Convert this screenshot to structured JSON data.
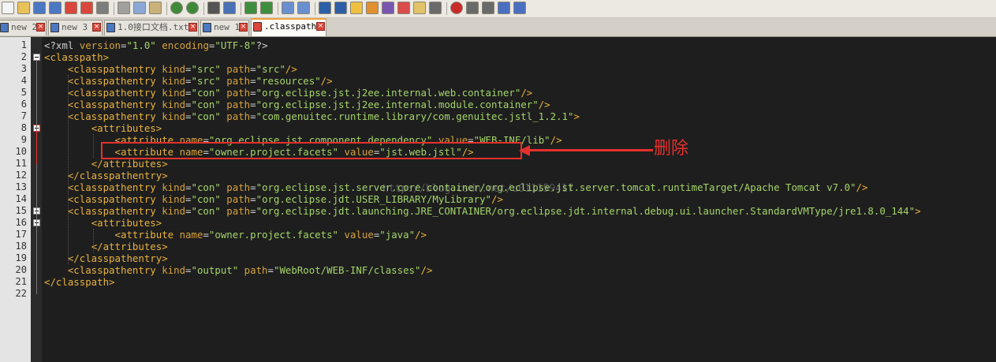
{
  "toolbar": {
    "buttons": [
      "new-file-icon",
      "open-file-icon",
      "save-icon",
      "save-all-icon",
      "close-icon",
      "close-all-icon",
      "print-icon",
      "cut-icon",
      "copy-icon",
      "paste-icon",
      "undo-icon",
      "redo-icon",
      "find-icon",
      "replace-icon",
      "zoom-in-icon",
      "zoom-out-icon",
      "sync-scroll-icon",
      "sync-h-icon",
      "wrap-icon",
      "show-all-chars-icon",
      "indent-guide-icon",
      "lang-icon",
      "function-list-icon",
      "doc-map-icon",
      "folder-icon",
      "monitor-icon",
      "record-macro-icon",
      "stop-macro-icon",
      "play-macro-icon",
      "run-macro-icon",
      "save-macro-icon"
    ]
  },
  "tabs": [
    {
      "label": "new 2",
      "active": false
    },
    {
      "label": "new 3",
      "active": false
    },
    {
      "label": "1.0接口文档.txt",
      "active": false
    },
    {
      "label": "new 1",
      "active": false
    },
    {
      "label": ".classpath",
      "active": true
    }
  ],
  "editor": {
    "line_numbers": [
      "1",
      "2",
      "3",
      "4",
      "5",
      "6",
      "7",
      "8",
      "9",
      "10",
      "11",
      "12",
      "13",
      "14",
      "15",
      "16",
      "17",
      "18",
      "19",
      "20",
      "21",
      "22"
    ],
    "lines": [
      [
        [
          "t",
          "<?xml "
        ],
        [
          "a",
          "version"
        ],
        [
          "t",
          "="
        ],
        [
          "v",
          "\"1.0\""
        ],
        [
          "t",
          " "
        ],
        [
          "a",
          "encoding"
        ],
        [
          "t",
          "="
        ],
        [
          "v",
          "\"UTF-8\""
        ],
        [
          "t",
          "?>"
        ]
      ],
      [
        [
          "g",
          "<classpath>"
        ]
      ],
      [
        [
          "s",
          "    "
        ],
        [
          "g",
          "<classpathentry "
        ],
        [
          "a",
          "kind"
        ],
        [
          "t",
          "="
        ],
        [
          "v",
          "\"src\""
        ],
        [
          "t",
          " "
        ],
        [
          "a",
          "path"
        ],
        [
          "t",
          "="
        ],
        [
          "v",
          "\"src\""
        ],
        [
          "g",
          "/>"
        ]
      ],
      [
        [
          "s",
          "    "
        ],
        [
          "g",
          "<classpathentry "
        ],
        [
          "a",
          "kind"
        ],
        [
          "t",
          "="
        ],
        [
          "v",
          "\"src\""
        ],
        [
          "t",
          " "
        ],
        [
          "a",
          "path"
        ],
        [
          "t",
          "="
        ],
        [
          "v",
          "\"resources\""
        ],
        [
          "g",
          "/>"
        ]
      ],
      [
        [
          "s",
          "    "
        ],
        [
          "g",
          "<classpathentry "
        ],
        [
          "a",
          "kind"
        ],
        [
          "t",
          "="
        ],
        [
          "v",
          "\"con\""
        ],
        [
          "t",
          " "
        ],
        [
          "a",
          "path"
        ],
        [
          "t",
          "="
        ],
        [
          "v",
          "\"org.eclipse.jst.j2ee.internal.web.container\""
        ],
        [
          "g",
          "/>"
        ]
      ],
      [
        [
          "s",
          "    "
        ],
        [
          "g",
          "<classpathentry "
        ],
        [
          "a",
          "kind"
        ],
        [
          "t",
          "="
        ],
        [
          "v",
          "\"con\""
        ],
        [
          "t",
          " "
        ],
        [
          "a",
          "path"
        ],
        [
          "t",
          "="
        ],
        [
          "v",
          "\"org.eclipse.jst.j2ee.internal.module.container\""
        ],
        [
          "g",
          "/>"
        ]
      ],
      [
        [
          "s",
          "    "
        ],
        [
          "g",
          "<classpathentry "
        ],
        [
          "a",
          "kind"
        ],
        [
          "t",
          "="
        ],
        [
          "v",
          "\"con\""
        ],
        [
          "t",
          " "
        ],
        [
          "a",
          "path"
        ],
        [
          "t",
          "="
        ],
        [
          "v",
          "\"com.genuitec.runtime.library/com.genuitec.jstl_1.2.1\""
        ],
        [
          "g",
          ">"
        ]
      ],
      [
        [
          "s",
          "        "
        ],
        [
          "g",
          "<attributes>"
        ]
      ],
      [
        [
          "s",
          "            "
        ],
        [
          "g",
          "<attribute "
        ],
        [
          "a",
          "name"
        ],
        [
          "t",
          "="
        ],
        [
          "v",
          "\"org.eclipse.jst.component.dependency\""
        ],
        [
          "t",
          " "
        ],
        [
          "a",
          "value"
        ],
        [
          "t",
          "="
        ],
        [
          "v",
          "\"WEB-INF/lib\""
        ],
        [
          "g",
          "/>"
        ]
      ],
      [
        [
          "s",
          "            "
        ],
        [
          "g",
          "<attribute "
        ],
        [
          "a",
          "name"
        ],
        [
          "t",
          "="
        ],
        [
          "v",
          "\"owner.project.facets\""
        ],
        [
          "t",
          " "
        ],
        [
          "a",
          "value"
        ],
        [
          "t",
          "="
        ],
        [
          "v",
          "\"jst.web.jstl\""
        ],
        [
          "g",
          "/>"
        ]
      ],
      [
        [
          "s",
          "        "
        ],
        [
          "g",
          "</attributes>"
        ]
      ],
      [
        [
          "s",
          "    "
        ],
        [
          "g",
          "</classpathentry>"
        ]
      ],
      [
        [
          "s",
          "    "
        ],
        [
          "g",
          "<classpathentry "
        ],
        [
          "a",
          "kind"
        ],
        [
          "t",
          "="
        ],
        [
          "v",
          "\"con\""
        ],
        [
          "t",
          " "
        ],
        [
          "a",
          "path"
        ],
        [
          "t",
          "="
        ],
        [
          "v",
          "\"org.eclipse.jst.server.core.container/org.eclipse.jst.server.tomcat.runtimeTarget/Apache Tomcat v7.0\""
        ],
        [
          "g",
          "/>"
        ]
      ],
      [
        [
          "s",
          "    "
        ],
        [
          "g",
          "<classpathentry "
        ],
        [
          "a",
          "kind"
        ],
        [
          "t",
          "="
        ],
        [
          "v",
          "\"con\""
        ],
        [
          "t",
          " "
        ],
        [
          "a",
          "path"
        ],
        [
          "t",
          "="
        ],
        [
          "v",
          "\"org.eclipse.jdt.USER_LIBRARY/MyLibrary\""
        ],
        [
          "g",
          "/>"
        ]
      ],
      [
        [
          "s",
          "    "
        ],
        [
          "g",
          "<classpathentry "
        ],
        [
          "a",
          "kind"
        ],
        [
          "t",
          "="
        ],
        [
          "v",
          "\"con\""
        ],
        [
          "t",
          " "
        ],
        [
          "a",
          "path"
        ],
        [
          "t",
          "="
        ],
        [
          "v",
          "\"org.eclipse.jdt.launching.JRE_CONTAINER/org.eclipse.jdt.internal.debug.ui.launcher.StandardVMType/jre1.8.0_144\""
        ],
        [
          "g",
          ">"
        ]
      ],
      [
        [
          "s",
          "        "
        ],
        [
          "g",
          "<attributes>"
        ]
      ],
      [
        [
          "s",
          "            "
        ],
        [
          "g",
          "<attribute "
        ],
        [
          "a",
          "name"
        ],
        [
          "t",
          "="
        ],
        [
          "v",
          "\"owner.project.facets\""
        ],
        [
          "t",
          " "
        ],
        [
          "a",
          "value"
        ],
        [
          "t",
          "="
        ],
        [
          "v",
          "\"java\""
        ],
        [
          "g",
          "/>"
        ]
      ],
      [
        [
          "s",
          "        "
        ],
        [
          "g",
          "</attributes>"
        ]
      ],
      [
        [
          "s",
          "    "
        ],
        [
          "g",
          "</classpathentry>"
        ]
      ],
      [
        [
          "s",
          "    "
        ],
        [
          "g",
          "<classpathentry "
        ],
        [
          "a",
          "kind"
        ],
        [
          "t",
          "="
        ],
        [
          "v",
          "\"output\""
        ],
        [
          "t",
          " "
        ],
        [
          "a",
          "path"
        ],
        [
          "t",
          "="
        ],
        [
          "v",
          "\"WebRoot/WEB-INF/classes\""
        ],
        [
          "g",
          "/>"
        ]
      ],
      [
        [
          "g",
          "</classpath>"
        ]
      ],
      []
    ]
  },
  "annotation": {
    "text": "删除",
    "color": "#e5302d"
  },
  "watermark": {
    "text": "http://blog.csdn.net/u011159417"
  },
  "colors": {
    "tag": "#e9b23f",
    "attr": "#d6a23c",
    "value": "#a4d56a",
    "text": "#d0d0d0",
    "accent": "#e5302d"
  }
}
